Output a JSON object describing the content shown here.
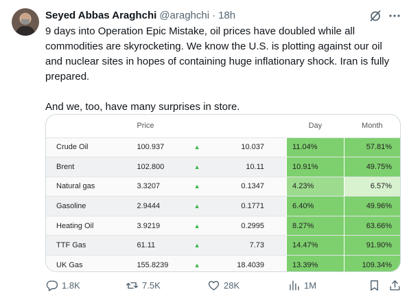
{
  "tweet": {
    "author_name": "Seyed Abbas Araghchi",
    "handle": "@araghchi",
    "separator": "·",
    "time": "18h",
    "paragraphs": [
      "9 days into Operation Epic Mistake, oil prices have doubled while all commodities are skyrocketing. We know the U.S. is plotting against our oil and nuclear sites in hopes of containing huge inflationary shock. Iran is fully prepared.",
      "And we, too, have many surprises in store."
    ]
  },
  "icons": {
    "header": [
      "grok-icon",
      "more-icon"
    ],
    "arrow": "up-arrow-icon"
  },
  "table": {
    "headers": {
      "name": "",
      "price": "Price",
      "arrow": "",
      "change": "",
      "day": "Day",
      "month": "Month"
    },
    "rows": [
      {
        "name": "Crude Oil",
        "price": "100.937",
        "change": "10.037",
        "day": "11.04%",
        "month": "57.81%",
        "day_color": "#7ed06e",
        "month_color": "#7ed06e"
      },
      {
        "name": "Brent",
        "price": "102.800",
        "change": "10.11",
        "day": "10.91%",
        "month": "49.75%",
        "day_color": "#7ed06e",
        "month_color": "#7ed06e"
      },
      {
        "name": "Natural gas",
        "price": "3.3207",
        "change": "0.1347",
        "day": "4.23%",
        "month": "6.57%",
        "day_color": "#9ddb8e",
        "month_color": "#d8f2cf"
      },
      {
        "name": "Gasoline",
        "price": "2.9444",
        "change": "0.1771",
        "day": "6.40%",
        "month": "49.96%",
        "day_color": "#7ed06e",
        "month_color": "#7ed06e"
      },
      {
        "name": "Heating Oil",
        "price": "3.9219",
        "change": "0.2995",
        "day": "8.27%",
        "month": "63.66%",
        "day_color": "#7ed06e",
        "month_color": "#7ed06e"
      },
      {
        "name": "TTF Gas",
        "price": "61.11",
        "change": "7.73",
        "day": "14.47%",
        "month": "91.90%",
        "day_color": "#7ed06e",
        "month_color": "#7ed06e"
      },
      {
        "name": "UK Gas",
        "price": "155.8239",
        "change": "18.4039",
        "day": "13.39%",
        "month": "109.34%",
        "day_color": "#7ed06e",
        "month_color": "#7ed06e"
      }
    ]
  },
  "actions": {
    "replies": "1.8K",
    "reposts": "7.5K",
    "likes": "28K",
    "views": "1M"
  },
  "colors": {
    "accent": "#1d9bf0",
    "muted": "#536471",
    "up": "#39b54a"
  }
}
